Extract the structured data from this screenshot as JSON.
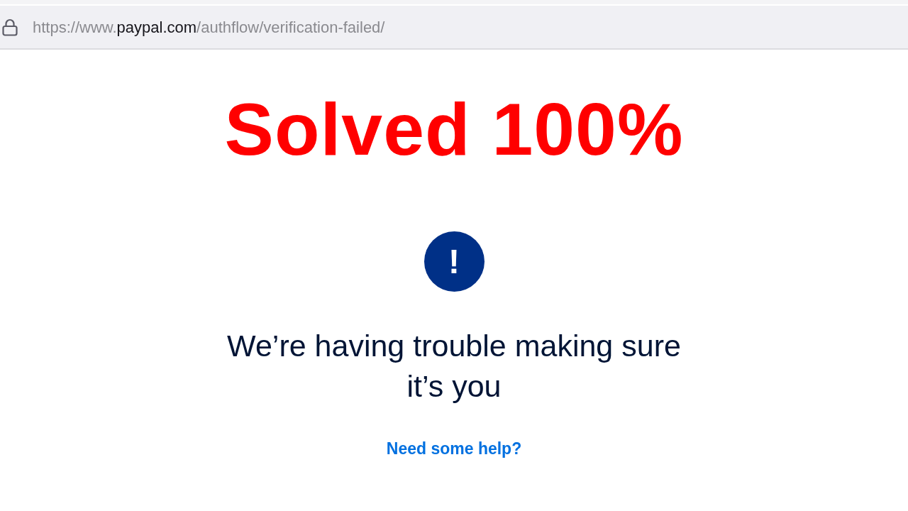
{
  "address_bar": {
    "url": {
      "scheme": "https://www.",
      "domain": "paypal.com",
      "path": "/authflow/verification-failed/"
    }
  },
  "overlay_caption": "Solved 100%",
  "alert": {
    "icon": "!",
    "heading": "We’re having trouble making sure it’s you",
    "help_link": "Need some help?"
  }
}
